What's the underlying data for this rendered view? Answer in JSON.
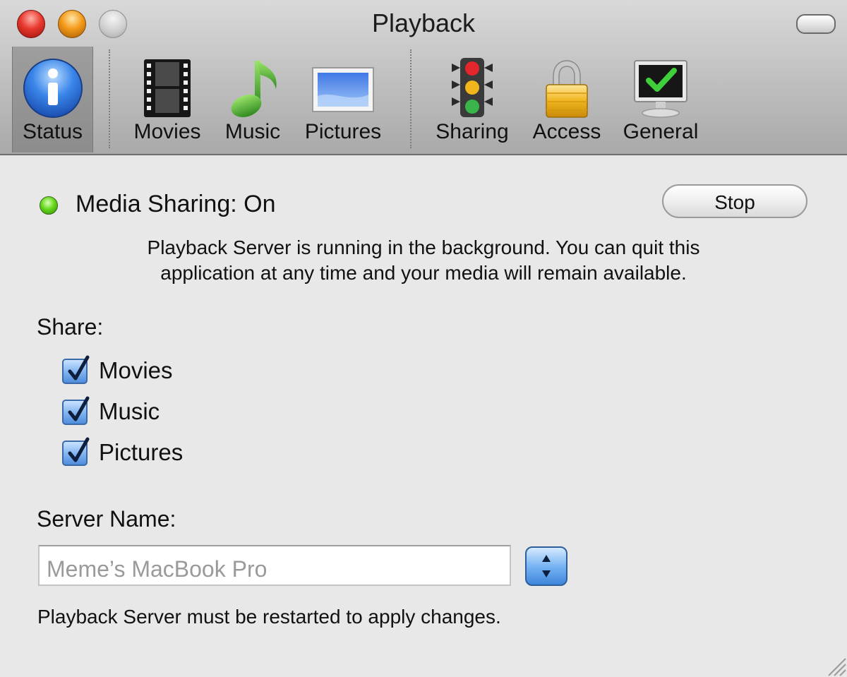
{
  "window": {
    "title": "Playback"
  },
  "toolbar": {
    "items": [
      {
        "label": "Status",
        "icon": "info-icon"
      },
      {
        "label": "Movies",
        "icon": "film-icon"
      },
      {
        "label": "Music",
        "icon": "music-note-icon"
      },
      {
        "label": "Pictures",
        "icon": "picture-icon"
      },
      {
        "label": "Sharing",
        "icon": "traffic-light-icon"
      },
      {
        "label": "Access",
        "icon": "padlock-icon"
      },
      {
        "label": "General",
        "icon": "monitor-check-icon"
      }
    ],
    "selected": "Status"
  },
  "status": {
    "text": "Media Sharing: On",
    "indicator_color": "#66d81d",
    "button_label": "Stop"
  },
  "info": {
    "line1": "Playback Server is running in the background. You can quit this",
    "line2": "application at any time and your media will remain available."
  },
  "share": {
    "label": "Share:",
    "options": [
      {
        "label": "Movies",
        "checked": true
      },
      {
        "label": "Music",
        "checked": true
      },
      {
        "label": "Pictures",
        "checked": true
      }
    ]
  },
  "server": {
    "label": "Server Name:",
    "placeholder": "Meme’s MacBook Pro",
    "note": "Playback Server must be restarted to apply changes."
  }
}
